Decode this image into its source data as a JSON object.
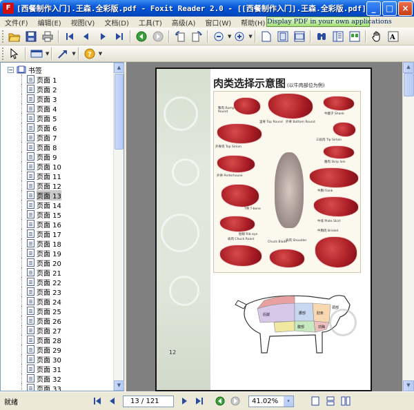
{
  "window": {
    "title": "[西餐制作入门].王森.全彩版.pdf - Foxit Reader 2.0 - [[西餐制作入门].王森.全彩版.pdf]",
    "app_icon_label": "F",
    "minimize": "_",
    "maximize": "□",
    "close": "×"
  },
  "menu": {
    "items": [
      "文件(F)",
      "编辑(E)",
      "视图(V)",
      "文档(D)",
      "工具(T)",
      "高级(A)",
      "窗口(W)",
      "帮助(H)"
    ],
    "promo": "Display PDF in your own applications"
  },
  "colors": {
    "accent": "#0a5ad8",
    "selection": "#c8c8c8",
    "doc_background": "#808080"
  },
  "toolbar": {
    "icons": [
      "open-icon",
      "save-icon",
      "print-icon",
      "first-page-icon",
      "prev-page-icon",
      "next-page-icon",
      "last-page-icon",
      "go-back-icon",
      "go-forward-icon",
      "rotate-left-icon",
      "rotate-right-icon",
      "zoom-out-icon",
      "zoom-in-icon",
      "single-page-icon",
      "fit-page-icon",
      "fit-width-icon",
      "find-icon",
      "bookmarks-icon",
      "thumbnails-icon",
      "hand-icon",
      "text-select-icon"
    ],
    "row2_icons": [
      "select-icon",
      "comment-tool-icon",
      "arrow-tool-icon",
      "help-icon"
    ]
  },
  "bookmarks": {
    "root_label": "书签",
    "expand_symbol": "−",
    "items": [
      "页面 1",
      "页面 2",
      "页面 3",
      "页面 4",
      "页面 5",
      "页面 6",
      "页面 7",
      "页面 8",
      "页面 9",
      "页面 10",
      "页面 11",
      "页面 12",
      "页面 13",
      "页面 14",
      "页面 15",
      "页面 16",
      "页面 17",
      "页面 18",
      "页面 19",
      "页面 20",
      "页面 21",
      "页面 22",
      "页面 23",
      "页面 24",
      "页面 25",
      "页面 26",
      "页面 27",
      "页面 28",
      "页面 29",
      "页面 30",
      "页面 31",
      "页面 32",
      "页面 33"
    ],
    "selected": "页面 13"
  },
  "page": {
    "heading": "肉类选择示意图",
    "subheading": "(以牛肉部位为例)",
    "page_number": "12",
    "cut_labels": [
      "臀肉 Rump Round",
      "里脊 Top Round",
      "外脊 Bottom Round",
      "牛腱子 Shank",
      "外脊肉 Top Sirloin",
      "三段肉 Tip Sirloin",
      "外脊 Porterhouse",
      "腰肉 Strip loin",
      "T骨 T-bone",
      "牛胸 Flank",
      "肋眼 Rib eye",
      "牛排 Plate Skirt",
      "肩肉 Chuck Roast",
      "Chuck Blade",
      "肩肉 Shoulder",
      "牛胸肉 Brisket"
    ],
    "cow_labels": [
      "后腿",
      "腰部",
      "肋条",
      "颈部",
      "前胸",
      "腹部"
    ]
  },
  "status": {
    "text": "就绪",
    "page_indicator": "13 / 121",
    "zoom": "41.02%",
    "zoom_drop": "▾"
  }
}
